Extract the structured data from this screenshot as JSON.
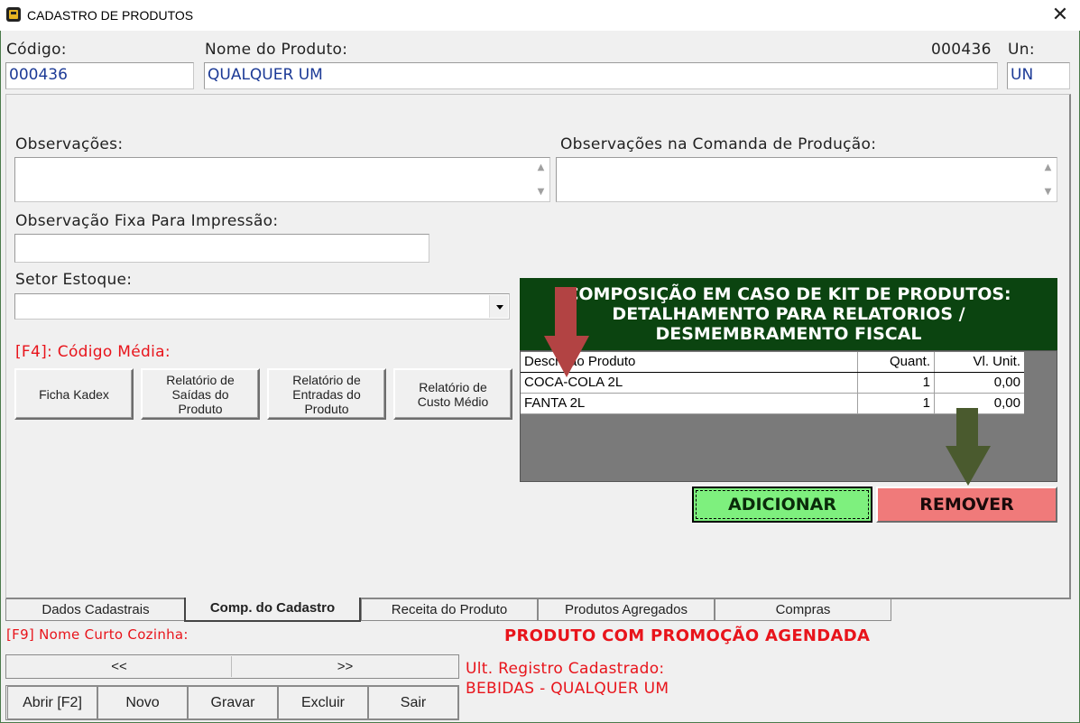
{
  "window": {
    "title": "CADASTRO DE PRODUTOS",
    "close_glyph": "✕"
  },
  "header": {
    "codigo_label": "Código:",
    "codigo_value": "000436",
    "nome_label": "Nome do Produto:",
    "nome_value": "QUALQUER UM",
    "code_display": "000436",
    "un_label": "Un:",
    "un_value": "UN"
  },
  "panel": {
    "observacoes_label": "Observações:",
    "observacoes_value": "",
    "obs_comanda_label": "Observações na Comanda de Produção:",
    "obs_comanda_value": "",
    "obs_fixa_label": "Observação Fixa Para Impressão:",
    "obs_fixa_value": "",
    "setor_label": "Setor Estoque:",
    "setor_value": "",
    "codigo_media_label": "[F4]: Código Média:",
    "buttons": {
      "ficha_kadex": "Ficha Kadex",
      "rel_saidas": "Relatório de Saídas do Produto",
      "rel_entradas": "Relatório de Entradas do Produto",
      "rel_custo": "Relatório de Custo Médio"
    }
  },
  "kit": {
    "header_line1": "COMPOSIÇÃO EM CASO DE KIT DE PRODUTOS:",
    "header_line2": "DETALHAMENTO PARA RELATORIOS /",
    "header_line3": "DESMEMBRAMENTO FISCAL",
    "columns": [
      "Descrição Produto",
      "Quant.",
      "Vl. Unit."
    ],
    "rows": [
      {
        "descricao": "COCA-COLA 2L",
        "quant": "1",
        "vl_unit": "0,00"
      },
      {
        "descricao": "FANTA 2L",
        "quant": "1",
        "vl_unit": "0,00"
      }
    ],
    "add_label": "ADICIONAR",
    "remove_label": "REMOVER"
  },
  "tabs": [
    "Dados Cadastrais",
    "Comp. do Cadastro",
    "Receita do Produto",
    "Produtos Agregados",
    "Compras"
  ],
  "active_tab": "Comp. do Cadastro",
  "footer": {
    "nome_curto_label": "[F9] Nome Curto Cozinha:",
    "promo_text": "PRODUTO COM PROMOÇÃO AGENDADA",
    "nav_prev": "<<",
    "nav_next": ">>",
    "ult_registro_label": "Ult. Registro Cadastrado:",
    "ult_registro_value": "BEBIDAS - QUALQUER UM",
    "actions": {
      "abrir": "Abrir [F2]",
      "novo": "Novo",
      "gravar": "Gravar",
      "excluir": "Excluir",
      "sair": "Sair"
    }
  },
  "colors": {
    "kit_header_bg": "#0b4410",
    "add_bg": "#7ef07e",
    "remove_bg": "#f07a7a",
    "label_red": "#e8141b",
    "input_text": "#1c3a96",
    "arrow_red": "#b24343",
    "arrow_green": "#4a5a2e"
  }
}
